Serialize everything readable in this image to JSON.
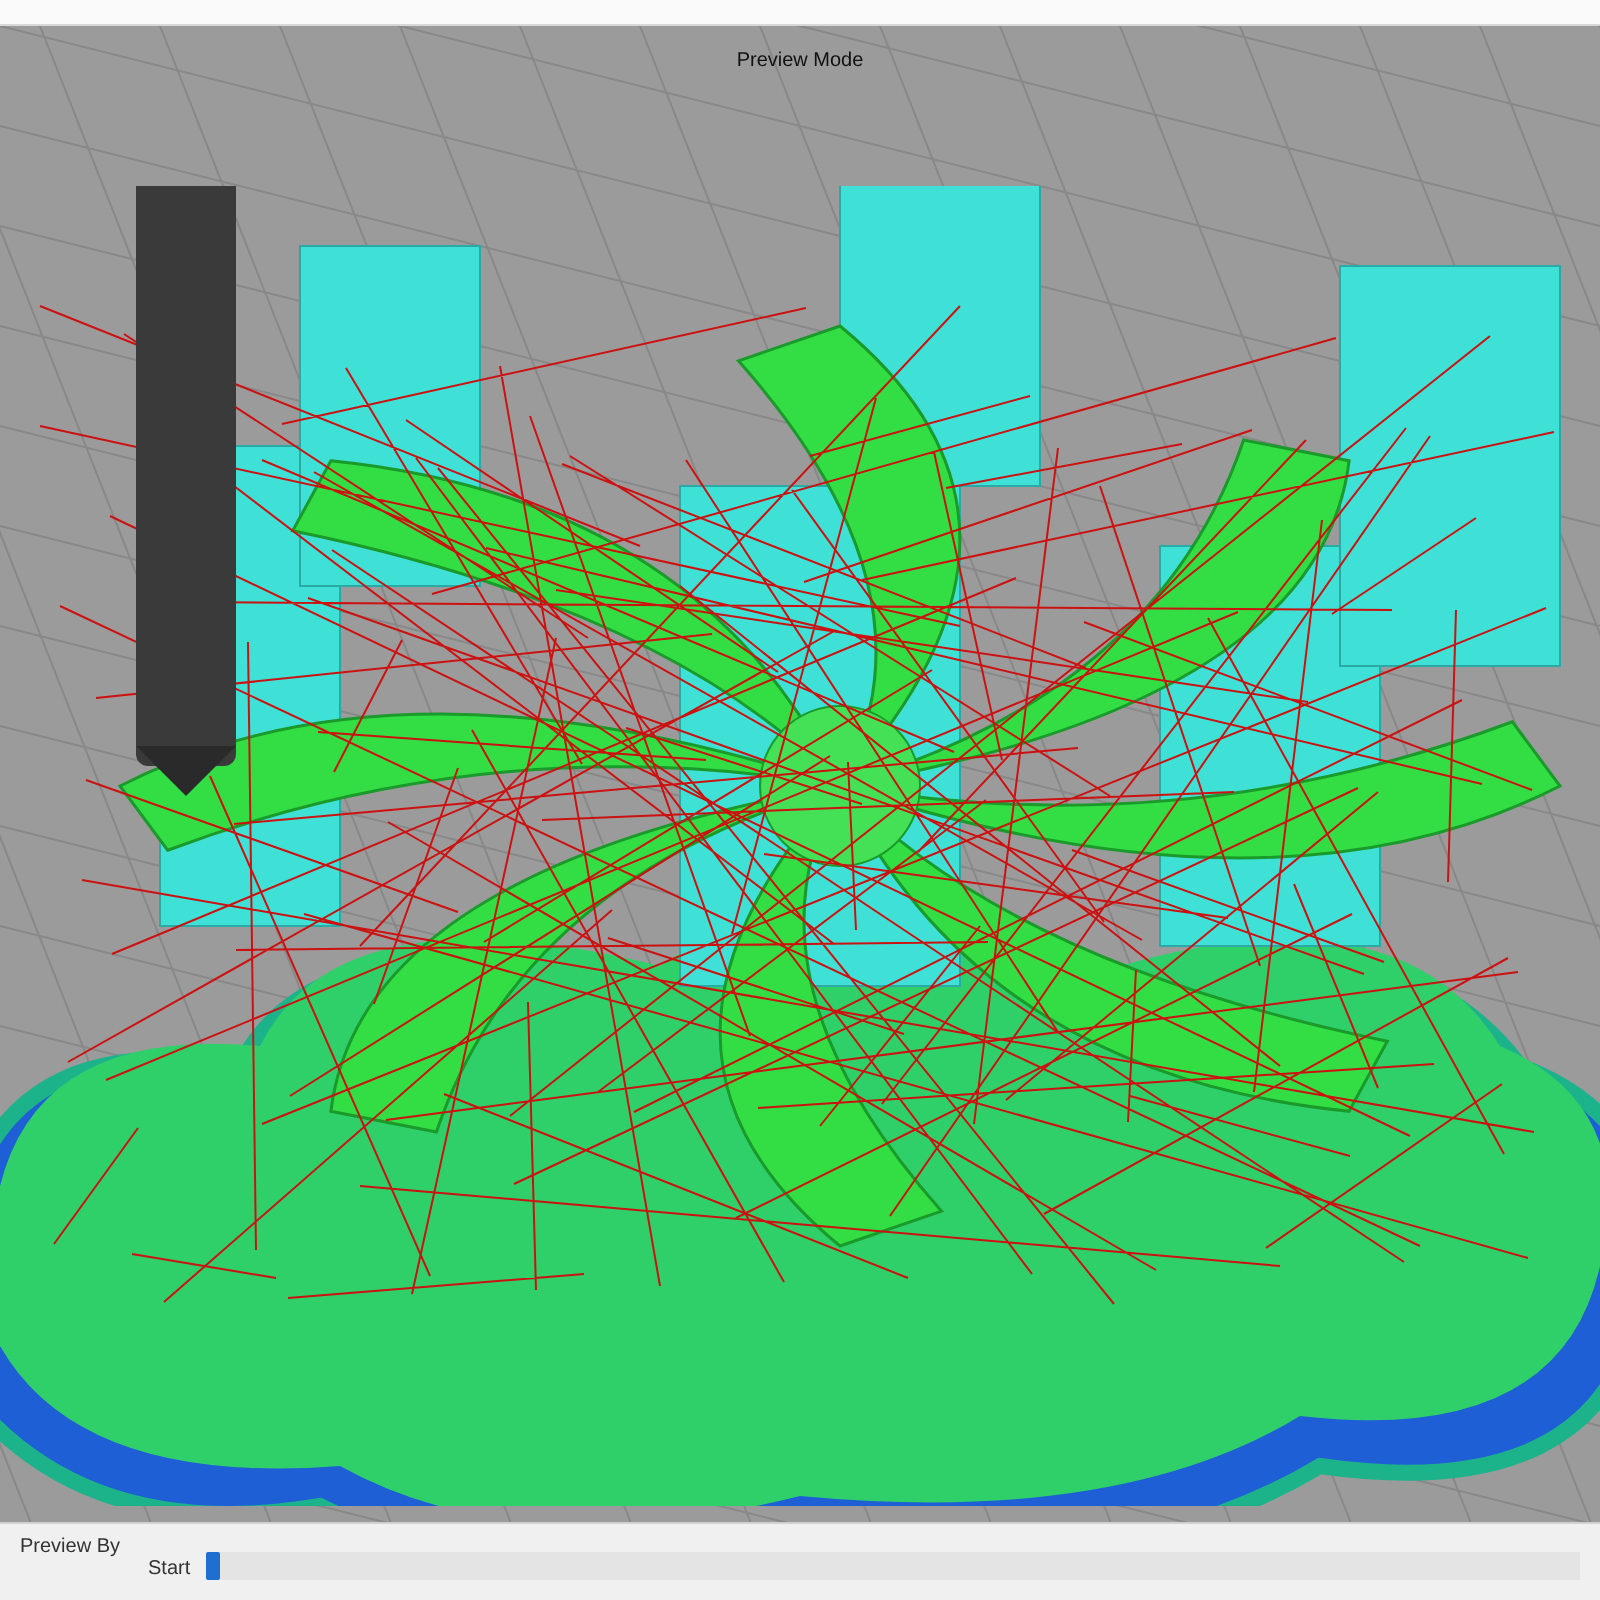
{
  "viewport": {
    "label": "Preview Mode"
  },
  "preview_panel": {
    "group_title": "Preview By",
    "slider": {
      "label": "Start",
      "level": 0
    }
  }
}
